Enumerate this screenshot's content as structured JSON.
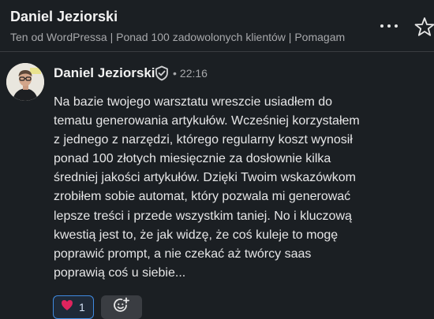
{
  "header": {
    "name": "Daniel Jeziorski",
    "subtitle": "Ten od WordPressa | Ponad 100 zadowolonych klientów | Pomagam"
  },
  "message": {
    "author": "Daniel Jeziorski",
    "time": "22:16",
    "lines": [
      "Na bazie twojego warsztatu wreszcie usiadłem do",
      "tematu generowania artykułów. Wcześniej korzystałem",
      "z jednego z narzędzi, którego regularny koszt wynosił",
      "ponad 100 złotych miesięcznie za dosłownie kilka",
      "średniej jakości artykułów. Dzięki Twoim wskazówkom",
      "zrobiłem sobie automat, który pozwala mi generować",
      "lepsze treści i przede wszystkim taniej. No i kluczową",
      "kwestią jest to, że jak widzę, że coś kuleje to mogę",
      "poprawić prompt, a nie czekać aż twórcy saas",
      "poprawią coś u siebie..."
    ],
    "reactions": [
      {
        "icon": "heart-icon",
        "count": "1"
      }
    ]
  },
  "icons": {
    "more": "more-horizontal-icon",
    "star": "star-icon",
    "verified": "verified-shield-icon",
    "add_reaction": "add-reaction-icon"
  },
  "colors": {
    "background": "#1b1f23",
    "accent_border": "#3f8ae0",
    "heart": "#e0245e"
  }
}
